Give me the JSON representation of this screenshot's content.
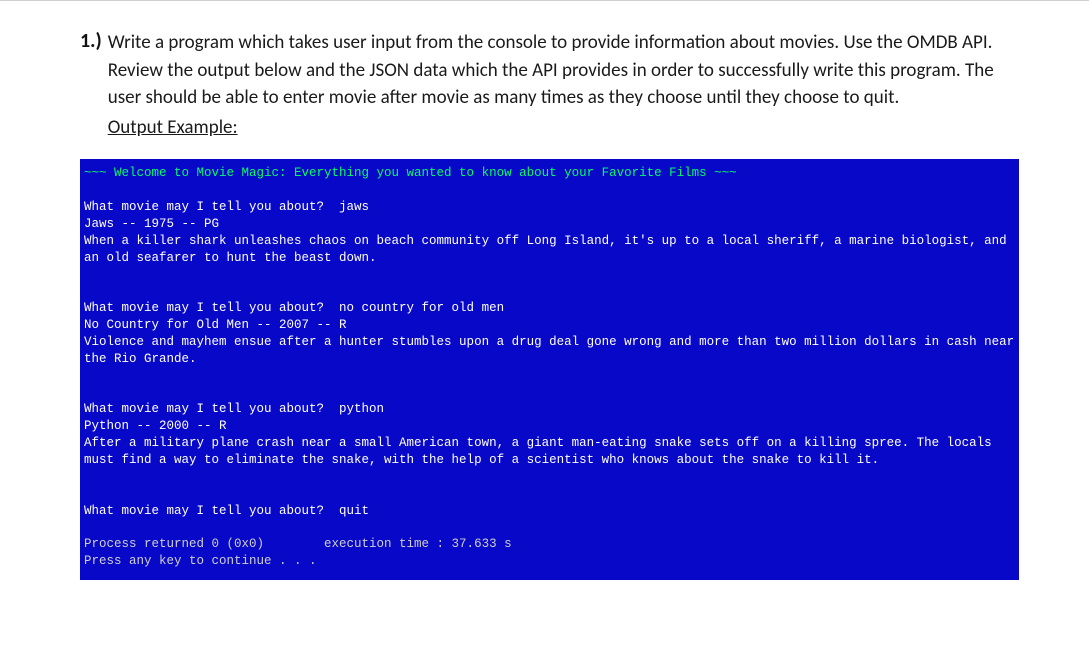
{
  "question": {
    "number": "1.)",
    "prompt_text": "Write a program which takes user input from the console to provide information about movies. Use the OMDB API. Review the output below and the JSON data which the API provides in order to successfully write this program. The user should be able to enter movie after movie as many times as they choose until they choose to quit.",
    "output_label": "Output Example:"
  },
  "console": {
    "welcome": "~~~ Welcome to Movie Magic: Everything you wanted to know about your Favorite Films ~~~",
    "prompt": "What movie may I tell you about?  ",
    "sessions": [
      {
        "input": "jaws",
        "title_line": "Jaws -- 1975 -- PG",
        "plot": "When a killer shark unleashes chaos on beach community off Long Island, it's up to a local sheriff, a marine biologist, and an old seafarer to hunt the beast down."
      },
      {
        "input": "no country for old men",
        "title_line": "No Country for Old Men -- 2007 -- R",
        "plot": "Violence and mayhem ensue after a hunter stumbles upon a drug deal gone wrong and more than two million dollars in cash near the Rio Grande."
      },
      {
        "input": "python",
        "title_line": "Python -- 2000 -- R",
        "plot": "After a military plane crash near a small American town, a giant man-eating snake sets off on a killing spree. The locals must find a way to eliminate the snake, with the help of a scientist who knows about the snake to kill it."
      }
    ],
    "quit_input": "quit",
    "process_line": "Process returned 0 (0x0)        execution time : 37.633 s",
    "press_key": "Press any key to continue . . ."
  }
}
